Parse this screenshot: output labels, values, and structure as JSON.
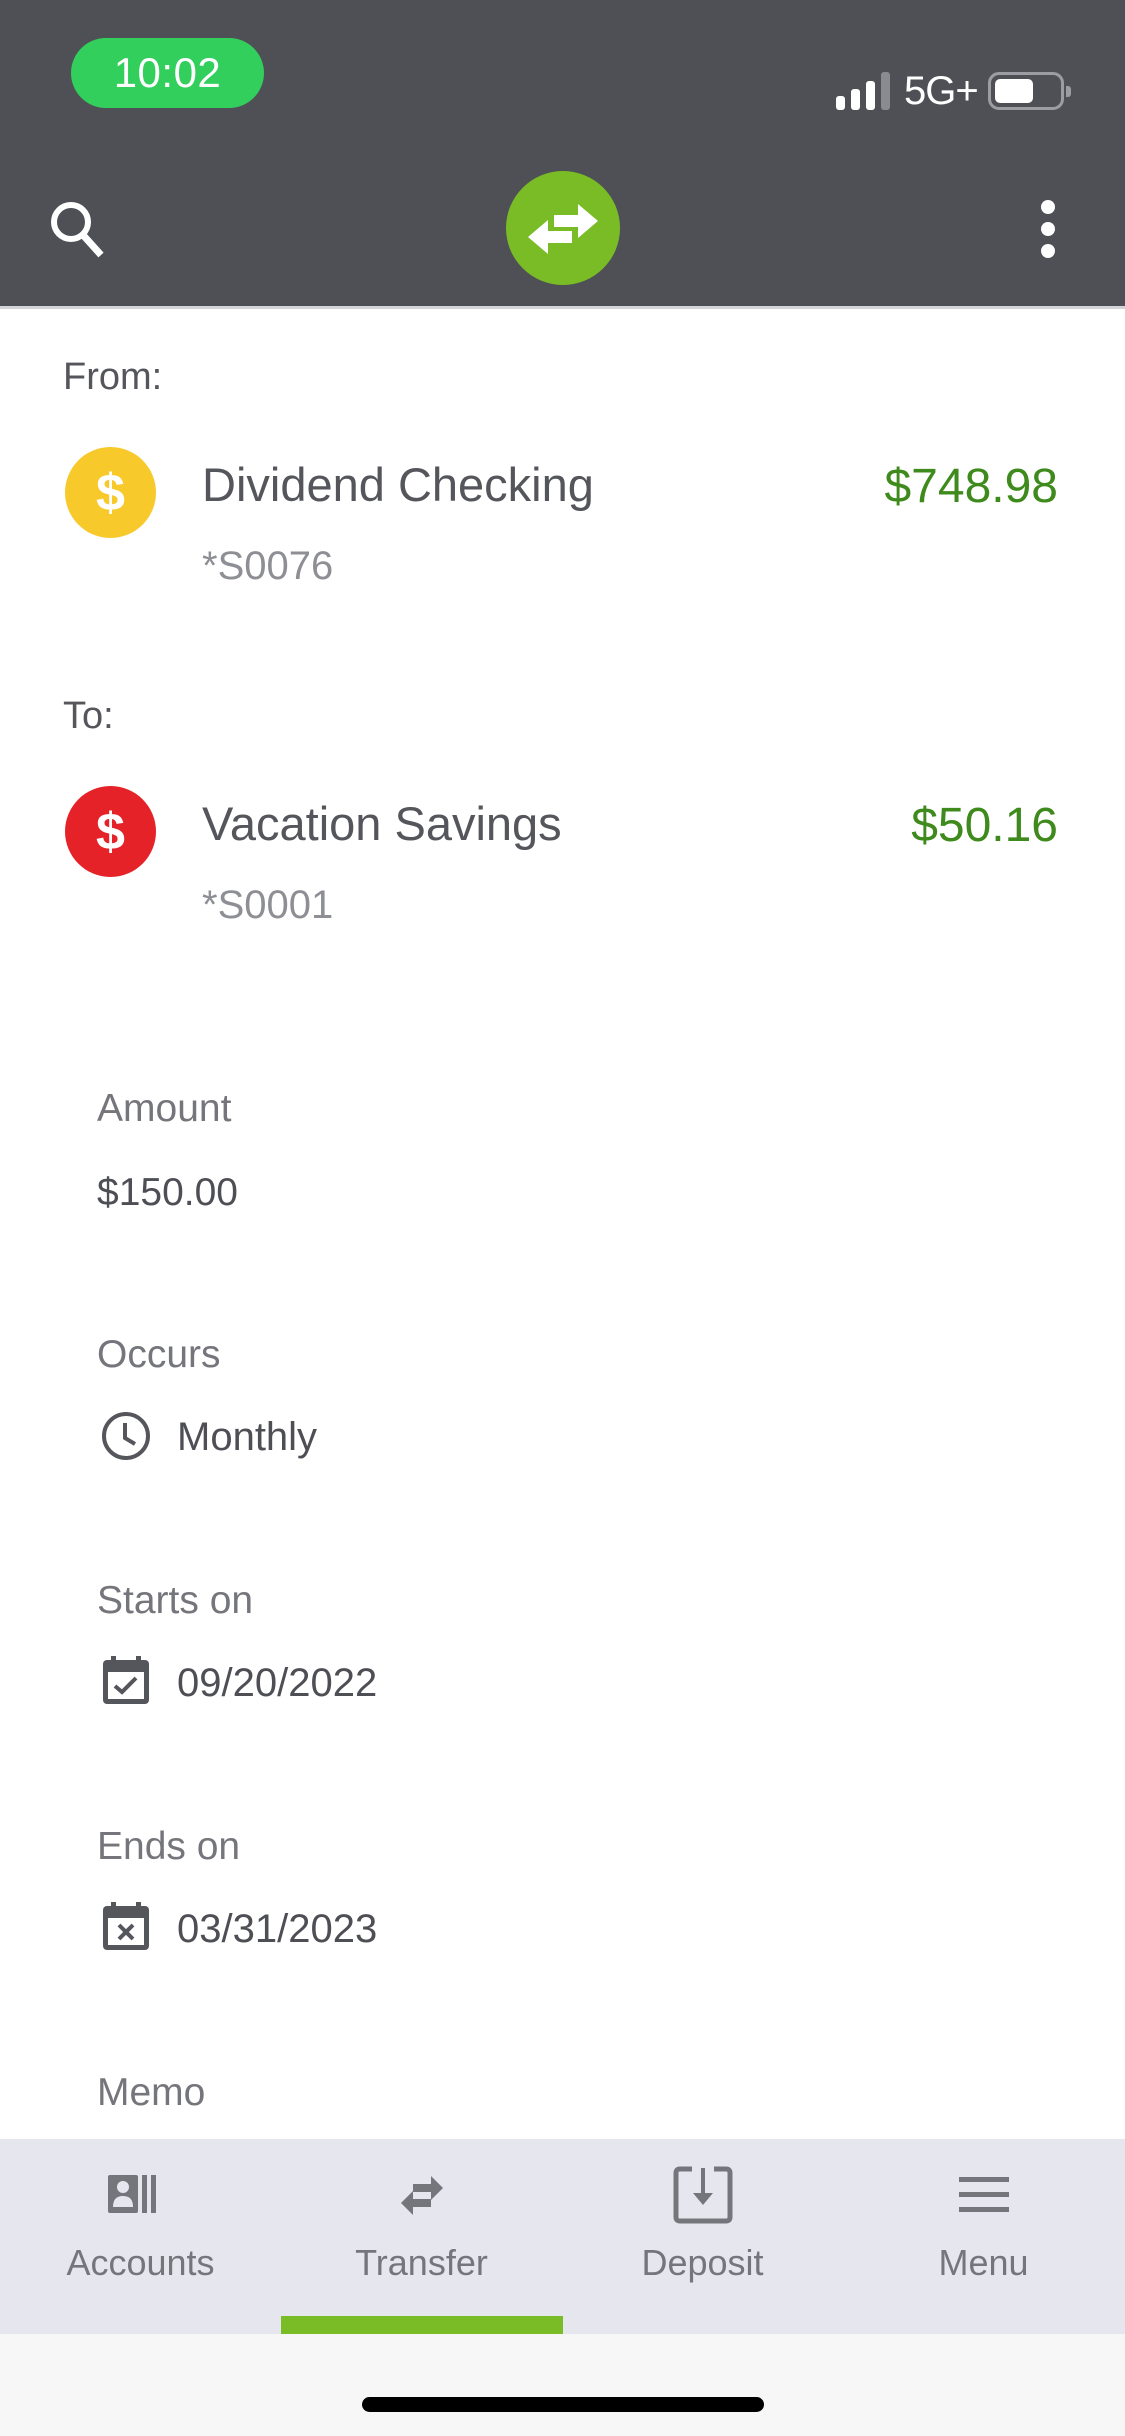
{
  "status_bar": {
    "time": "10:02",
    "network": "5G+",
    "signal_bars_active": 3,
    "signal_bars_total": 4,
    "icons": [
      "signal-icon",
      "battery-icon"
    ]
  },
  "header": {
    "left_icon": "search-icon",
    "center_icon": "transfer-arrows-icon",
    "right_icon": "more-vertical-icon",
    "accent_color": "#79bc26"
  },
  "transfer": {
    "from_label": "From:",
    "from_account": {
      "name": "Dividend Checking",
      "number": "*S0076",
      "balance": "$748.98",
      "icon": "dollar-icon",
      "icon_color": "#f8c92b"
    },
    "to_label": "To:",
    "to_account": {
      "name": "Vacation Savings",
      "number": "*S0001",
      "balance": "$50.16",
      "icon": "dollar-icon",
      "icon_color": "#e42228"
    },
    "balance_color": "#3f8a1c"
  },
  "details": {
    "amount_label": "Amount",
    "amount_value": "$150.00",
    "occurs_label": "Occurs",
    "occurs_value": "Monthly",
    "occurs_icon": "clock-icon",
    "starts_label": "Starts on",
    "starts_value": "09/20/2022",
    "starts_icon": "calendar-check-icon",
    "ends_label": "Ends on",
    "ends_value": "03/31/2023",
    "ends_icon": "calendar-x-icon",
    "memo_label": "Memo"
  },
  "tabbar": {
    "active_index": 1,
    "items": [
      {
        "label": "Accounts",
        "icon": "accounts-icon"
      },
      {
        "label": "Transfer",
        "icon": "transfer-icon"
      },
      {
        "label": "Deposit",
        "icon": "deposit-icon"
      },
      {
        "label": "Menu",
        "icon": "menu-icon"
      }
    ]
  }
}
